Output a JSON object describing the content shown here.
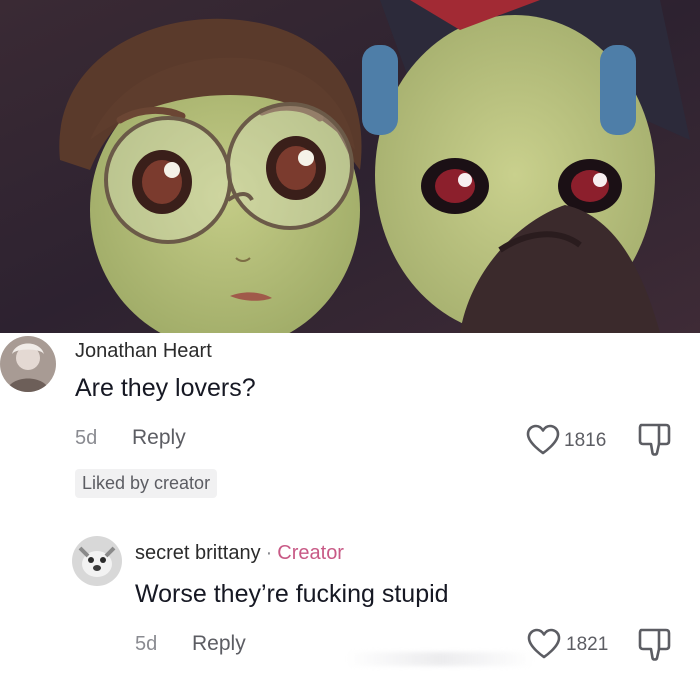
{
  "header_image": {
    "icon": "anime-two-characters-image"
  },
  "comments": [
    {
      "username": "Jonathan Heart",
      "text": "Are they lovers?",
      "age": "5d",
      "reply_label": "Reply",
      "likes": "1816",
      "badge": "Liked by creator",
      "avatar": "user-avatar-icon"
    },
    {
      "username": "secret brittany",
      "separator": "·",
      "role": "Creator",
      "text": "Worse they’re fucking stupid",
      "age": "5d",
      "reply_label": "Reply",
      "likes": "1821",
      "avatar": "creator-avatar-icon"
    }
  ],
  "colors": {
    "creator_tag": "#c85a86",
    "text": "#161823",
    "muted": "#8a8b91"
  }
}
